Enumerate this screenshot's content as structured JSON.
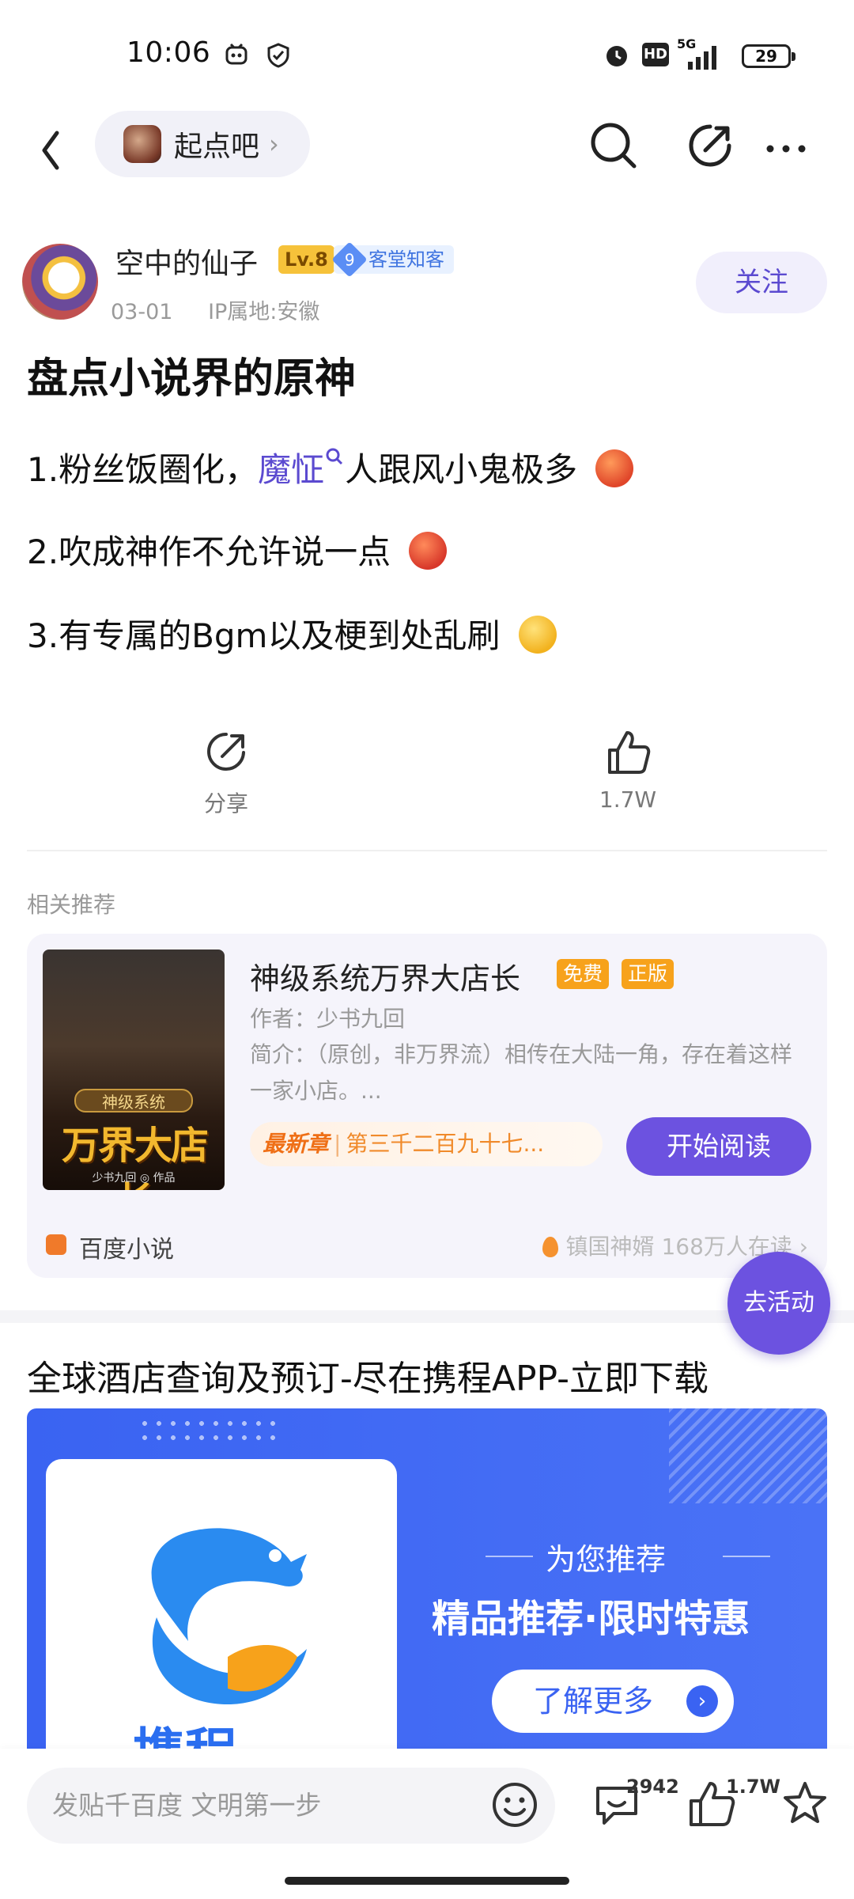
{
  "status_bar": {
    "time": "10:06",
    "network": "5G",
    "hd": "HD",
    "battery": "29",
    "icons": [
      "notification-icon",
      "shield-check-icon",
      "alarm-icon",
      "hd-icon",
      "signal-icon",
      "battery-icon"
    ]
  },
  "nav": {
    "forum_name": "起点吧",
    "icons": [
      "back-icon",
      "search-icon",
      "share-icon",
      "more-icon"
    ]
  },
  "post": {
    "author": "空中的仙子",
    "level": "Lv.8",
    "badge_num": "9",
    "badge_label": "客堂知客",
    "date": "03-01",
    "ip": "IP属地:安徽",
    "follow_label": "关注",
    "title": "盘点小说界的原神",
    "lines": [
      {
        "prefix": "1.粉丝饭圈化，",
        "link": "魔怔",
        "suffix": "人跟风小鬼极多"
      },
      {
        "text": "2.吹成神作不允许说一点"
      },
      {
        "text": "3.有专属的Bgm以及梗到处乱刷"
      }
    ]
  },
  "actions": {
    "share_label": "分享",
    "like_count": "1.7W"
  },
  "related": {
    "section_label": "相关推荐",
    "book": {
      "title": "神级系统万界大店长",
      "tag_free": "免费",
      "tag_official": "正版",
      "author": "作者：少书九回",
      "desc": "简介：（原创，非万界流）相传在大陆一角，存在着这样一家小店。...",
      "latest_tag": "最新章",
      "latest_chapter": "第三千二百九十七...",
      "read_button": "开始阅读",
      "cover_tag": "神级系统",
      "cover_title": "万界大店长",
      "cover_author": "少书九回 ◎ 作品",
      "source": "百度小说",
      "source_right": "镇国神婿 168万人在读 ›"
    }
  },
  "fab_label": "去活动",
  "ad": {
    "title": "全球酒店查询及预订-尽在携程APP-立即下载",
    "sub": "为您推荐",
    "main": "精品推荐·限时特惠",
    "button": "了解更多",
    "logo_text": "携程"
  },
  "bottom_bar": {
    "input_placeholder": "发贴千百度 文明第一步",
    "comment_count": "2942",
    "like_count": "1.7W",
    "icons": [
      "emoji-icon",
      "comment-icon",
      "like-icon",
      "star-icon"
    ]
  },
  "colors": {
    "accent": "#6c52e0",
    "follow_bg": "#f1effc",
    "orange": "#f7a21b",
    "ad_blue": "#3a63f2"
  }
}
